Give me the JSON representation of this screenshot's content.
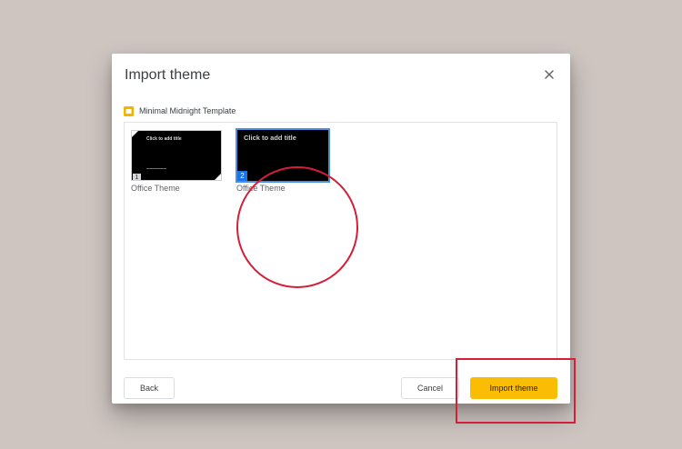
{
  "dialog": {
    "title": "Import theme",
    "close_icon": "close-icon"
  },
  "presentation": {
    "icon": "slides-icon",
    "icon_color": "#f4b400",
    "name": "Minimal Midnight Template"
  },
  "themes": [
    {
      "label": "Office Theme",
      "number": "1",
      "thumbnail_title": "Click to add title",
      "selected": false
    },
    {
      "label": "Office Theme",
      "number": "2",
      "thumbnail_title": "Click to add title",
      "selected": true
    }
  ],
  "buttons": {
    "back": "Back",
    "cancel": "Cancel",
    "import": "Import theme"
  },
  "colors": {
    "backdrop": "#cec5c1",
    "accent": "#fbbc04",
    "selection": "#4a90e2",
    "annotation": "#d41e3a"
  }
}
